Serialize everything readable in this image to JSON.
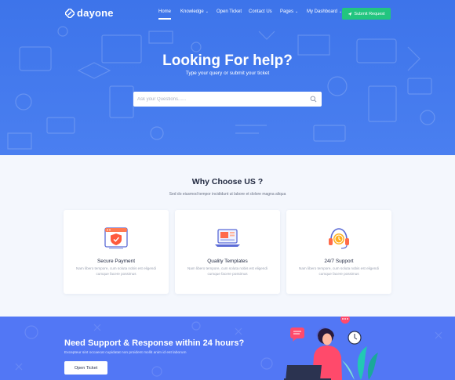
{
  "brand": {
    "name": "dayone"
  },
  "nav": {
    "items": [
      {
        "label": "Home",
        "active": true,
        "dropdown": false
      },
      {
        "label": "Knowledge",
        "active": false,
        "dropdown": true
      },
      {
        "label": "Open Ticket",
        "active": false,
        "dropdown": false
      },
      {
        "label": "Contact Us",
        "active": false,
        "dropdown": false
      },
      {
        "label": "Pages",
        "active": false,
        "dropdown": true
      },
      {
        "label": "My Dashboard",
        "active": false,
        "dropdown": true
      }
    ],
    "submit_label": "Submit Request"
  },
  "hero": {
    "title": "Looking For help?",
    "subtitle": "Type your query or submit your ticket",
    "search_placeholder": "Ask your Questions......"
  },
  "why": {
    "title": "Why Choose US ?",
    "subtitle": "Sed do eiusmod tempor incididunt ut labore et dolore magna aliqua",
    "cards": [
      {
        "title": "Secure Payment",
        "text": "Nam libero tempore, cum soluta nobis est eligendi cumque facere possimus",
        "icon": "shield-laptop-icon"
      },
      {
        "title": "Quality Templates",
        "text": "Nam libero tempore, cum soluta nobis est eligendi cumque facere possimus",
        "icon": "laptop-template-icon"
      },
      {
        "title": "24/7 Support",
        "text": "Nam libero tempore, cum soluta nobis est eligendi cumque facere possimus",
        "icon": "headset-support-icon"
      }
    ]
  },
  "cta": {
    "title": "Need Support & Response within 24 hours?",
    "subtitle": "Excepteur sint occaecat cupidatat non proident mollit anim id est laborum",
    "button_label": "Open Ticket"
  },
  "colors": {
    "hero_bg": "#3d74ea",
    "accent_green": "#22c57f",
    "cta_bg": "#5277f5",
    "page_bg": "#f4f7fd",
    "heading_dark": "#222a41"
  }
}
